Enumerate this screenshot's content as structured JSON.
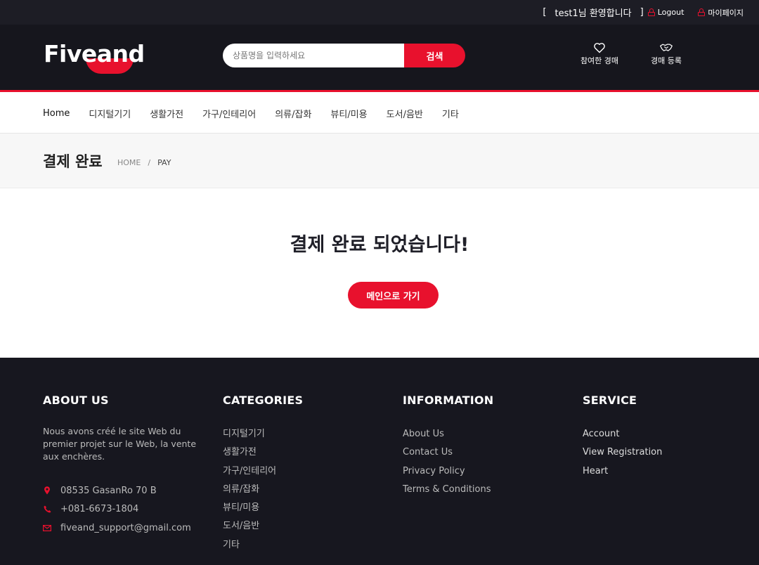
{
  "topbar": {
    "welcome_open": "[",
    "welcome": "test1님 환영합니다",
    "welcome_close": "]",
    "logout": "Logout",
    "mypage": "마이페이지"
  },
  "header": {
    "logo": "Fiveand",
    "search_placeholder": "상품명을 입력하세요",
    "search_button": "검색",
    "bid_link": "참여한 경매",
    "register_link": "경매 등록"
  },
  "nav": [
    "Home",
    "디지털기기",
    "생활가전",
    "가구/인테리어",
    "의류/잡화",
    "뷰티/미용",
    "도서/음반",
    "기타"
  ],
  "breadcrumb": {
    "title": "결제 완료",
    "home": "HOME",
    "sep": "/",
    "current": "PAY"
  },
  "main": {
    "message": "결제 완료 되었습니다!",
    "button": "메인으로 가기"
  },
  "footer": {
    "about": {
      "heading": "ABOUT US",
      "text": "Nous avons créé le site Web du premier projet sur le Web, la vente aux enchères.",
      "address": "08535 GasanRo 70 B",
      "phone": "+081-6673-1804",
      "email": "fiveand_support@gmail.com"
    },
    "categories": {
      "heading": "CATEGORIES",
      "items": [
        "디지털기기",
        "생활가전",
        "가구/인테리어",
        "의류/잡화",
        "뷰티/미용",
        "도서/음반",
        "기타"
      ]
    },
    "information": {
      "heading": "INFORMATION",
      "items": [
        "About Us",
        "Contact Us",
        "Privacy Policy",
        "Terms & Conditions"
      ]
    },
    "service": {
      "heading": "SERVICE",
      "items": [
        "Account",
        "View Registration",
        "Heart"
      ]
    }
  },
  "colors": {
    "accent": "#e8112d",
    "dark": "#16161d"
  }
}
